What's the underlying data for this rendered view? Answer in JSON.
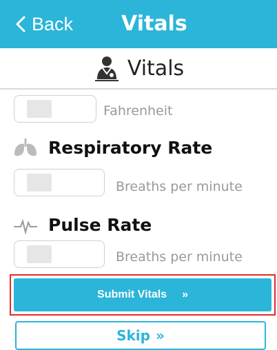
{
  "header": {
    "back_label": "Back",
    "title": "Vitals",
    "background_color": "#2bb5d8"
  },
  "subheader": {
    "title": "Vitals",
    "icon": "doctor-icon"
  },
  "temperature": {
    "unit": "Fahrenheit",
    "value": ""
  },
  "respiratory": {
    "title": "Respiratory Rate",
    "icon": "lungs-icon",
    "unit": "Breaths per minute",
    "value": ""
  },
  "pulse": {
    "title": "Pulse Rate",
    "icon": "heartbeat-icon",
    "unit": "Breaths per minute",
    "value": ""
  },
  "actions": {
    "submit_label": "Submit Vitals",
    "submit_arrow": "»",
    "skip_label": "Skip",
    "skip_arrow": "»",
    "highlight_color": "#e02a2a"
  }
}
